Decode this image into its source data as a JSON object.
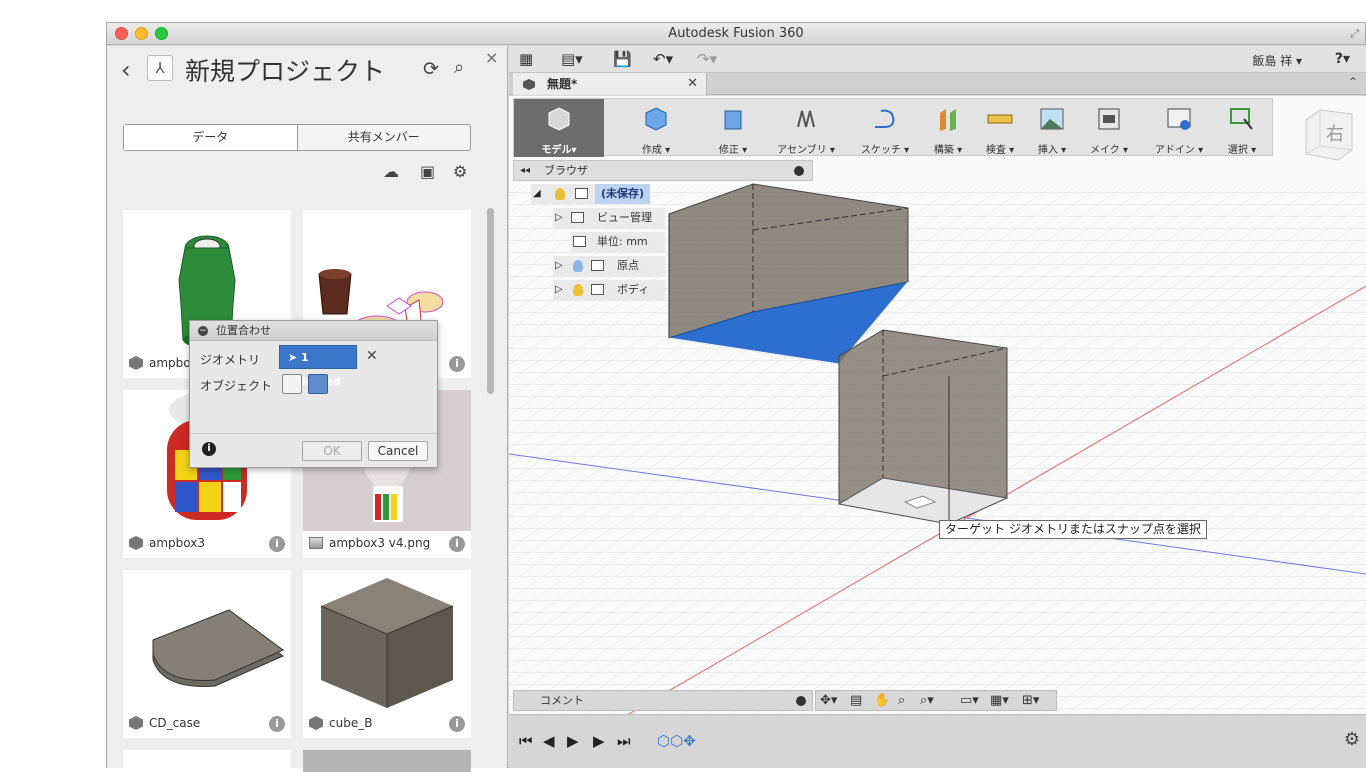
{
  "window": {
    "title": "Autodesk Fusion 360"
  },
  "data_panel": {
    "project_title": "新規プロジェクト",
    "tabs": [
      {
        "label": "データ",
        "active": true
      },
      {
        "label": "共有メンバー",
        "active": false
      }
    ],
    "items": [
      {
        "name": "ampbox",
        "type": "design"
      },
      {
        "name": "",
        "type": "design"
      },
      {
        "name": "ampbox3",
        "type": "design"
      },
      {
        "name": "ampbox3 v4.png",
        "type": "image"
      },
      {
        "name": "CD_case",
        "type": "design"
      },
      {
        "name": "cube_B",
        "type": "design"
      }
    ]
  },
  "align_dialog": {
    "title": "位置合わせ",
    "geometry_label": "ジオメトリ",
    "geometry_value": "1 selected",
    "object_label": "オブジェクト",
    "ok_label": "OK",
    "cancel_label": "Cancel"
  },
  "toolbar": {
    "user": "飯島 祥 ▾",
    "help": "?▾"
  },
  "document_tab": {
    "title": "無題*"
  },
  "ribbon": {
    "workspace": "モデル▾",
    "groups": [
      {
        "label": "作成 ▾"
      },
      {
        "label": "修正 ▾"
      },
      {
        "label": "アセンブリ ▾"
      },
      {
        "label": "スケッチ ▾"
      },
      {
        "label": "構築 ▾"
      },
      {
        "label": "検査 ▾"
      },
      {
        "label": "挿入 ▾"
      },
      {
        "label": "メイク ▾"
      },
      {
        "label": "アドイン ▾"
      },
      {
        "label": "選択 ▾"
      }
    ],
    "viewcube_face": "右"
  },
  "browser": {
    "title": "ブラウザ",
    "root": "(未保存)",
    "nodes": [
      {
        "label": "ビュー管理"
      },
      {
        "label": "単位: mm"
      },
      {
        "label": "原点"
      },
      {
        "label": "ボディ"
      }
    ]
  },
  "tooltip": "ターゲット ジオメトリまたはスナップ点を選択",
  "comment_bar": {
    "label": "コメント"
  },
  "colors": {
    "selection_blue": "#2d6fd1",
    "accent": "#3b78c9"
  }
}
